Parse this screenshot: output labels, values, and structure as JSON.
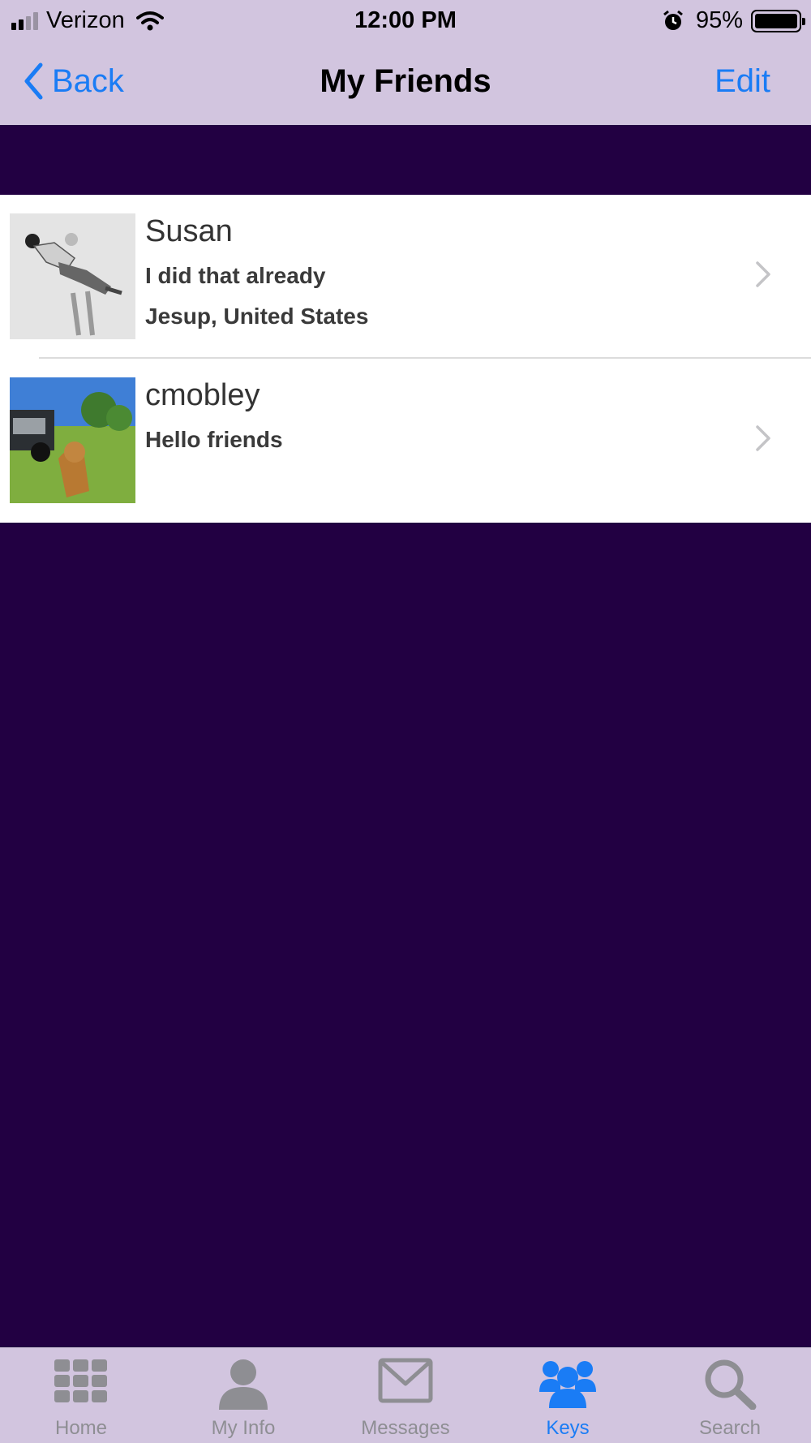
{
  "status_bar": {
    "carrier": "Verizon",
    "time": "12:00 PM",
    "battery": "95%"
  },
  "nav": {
    "back_label": "Back",
    "title": "My Friends",
    "edit_label": "Edit"
  },
  "friends": [
    {
      "name": "Susan",
      "status": "I did that already",
      "location": "Jesup, United States"
    },
    {
      "name": "cmobley",
      "status": "Hello friends",
      "location": ""
    }
  ],
  "tabs": [
    {
      "label": "Home",
      "icon": "grid-icon"
    },
    {
      "label": "My Info",
      "icon": "person-icon"
    },
    {
      "label": "Messages",
      "icon": "envelope-icon"
    },
    {
      "label": "Keys",
      "icon": "people-icon",
      "active": true
    },
    {
      "label": "Search",
      "icon": "magnifier-icon"
    }
  ],
  "colors": {
    "bar_background": "#d2c5df",
    "page_background": "#220042",
    "accent": "#1a7cf5",
    "inactive_tab": "#8e8e93"
  }
}
